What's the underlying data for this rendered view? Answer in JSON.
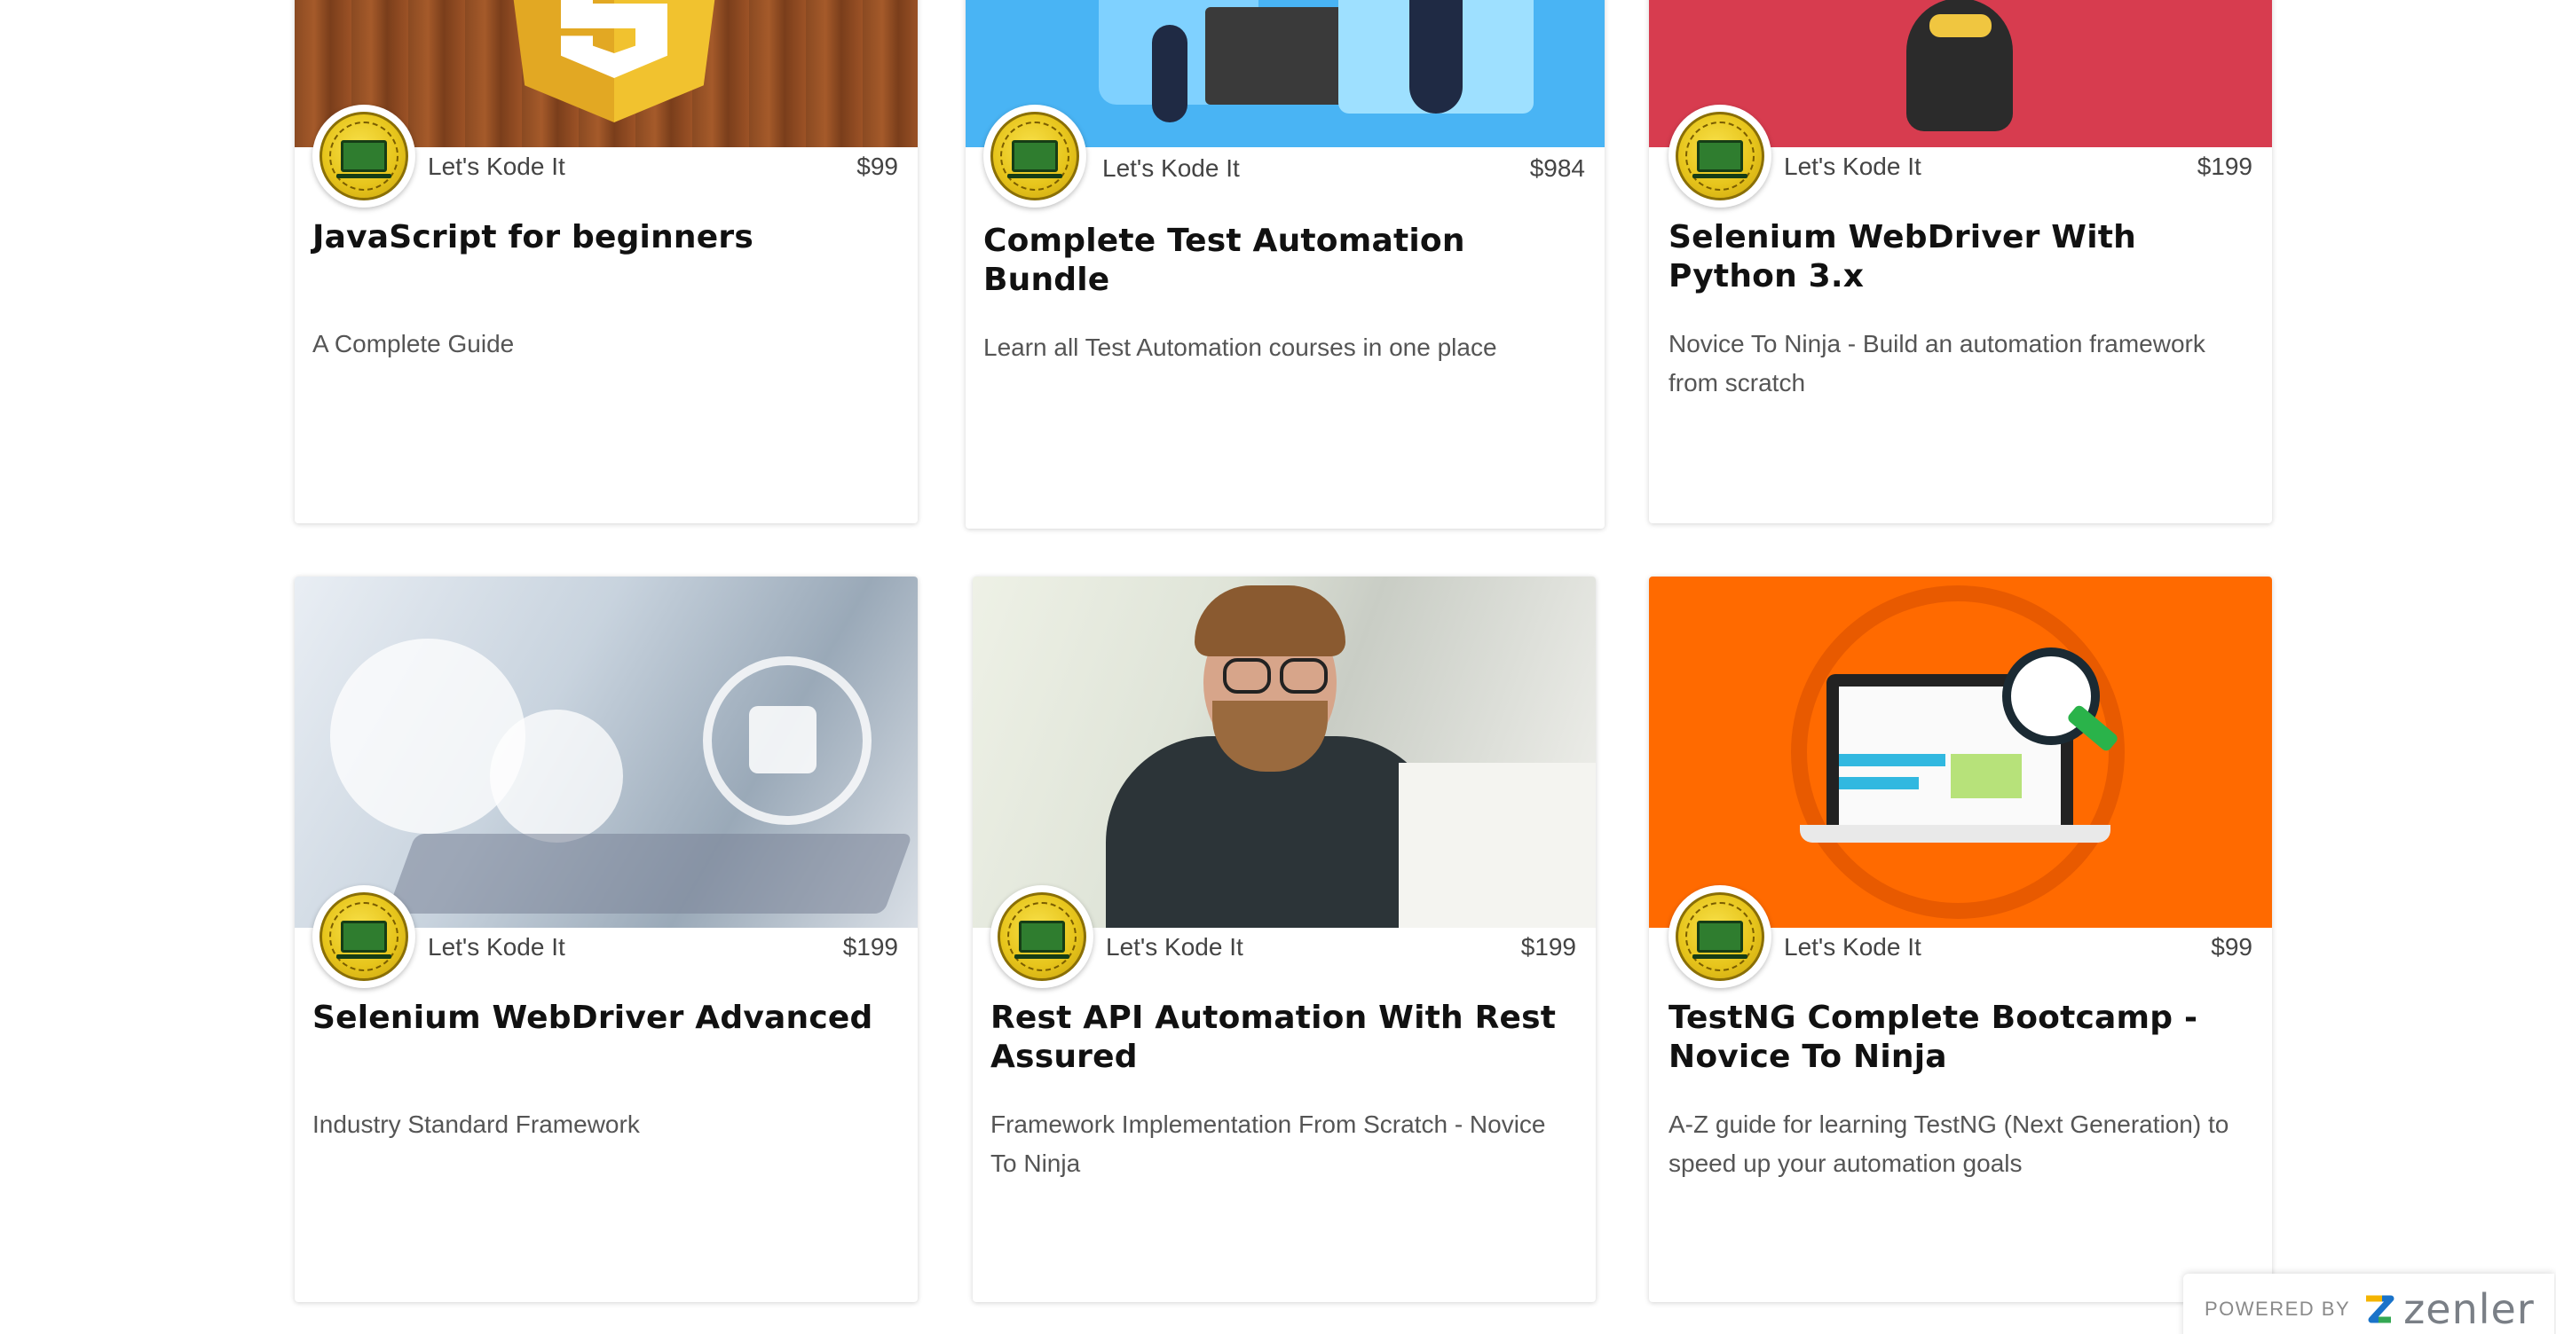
{
  "courses": [
    {
      "author": "Let's Kode It",
      "price": "$99",
      "title": "JavaScript for beginners",
      "subtitle": "A Complete Guide"
    },
    {
      "author": "Let's Kode It",
      "price": "$984",
      "title": "Complete Test Automation Bundle",
      "subtitle": "Learn all Test Automation courses in one place"
    },
    {
      "author": "Let's Kode It",
      "price": "$199",
      "title": "Selenium WebDriver With Python 3.x",
      "subtitle": "Novice To Ninja - Build an automation framework from scratch"
    },
    {
      "author": "Let's Kode It",
      "price": "$199",
      "title": "Selenium WebDriver Advanced",
      "subtitle": "Industry Standard Framework"
    },
    {
      "author": "Let's Kode It",
      "price": "$199",
      "title": "Rest API Automation With Rest Assured",
      "subtitle": "Framework Implementation From Scratch - Novice To Ninja"
    },
    {
      "author": "Let's Kode It",
      "price": "$99",
      "title": "TestNG Complete Bootcamp - Novice To Ninja",
      "subtitle": "A-Z guide for learning TestNG (Next Generation) to speed up your automation goals"
    }
  ],
  "footer": {
    "powered_by": "POWERED BY",
    "brand": "zenler"
  },
  "icons": {
    "avatar": "lets-kode-it-logo-icon",
    "brand_logo": "zenler-z-logo-icon"
  }
}
